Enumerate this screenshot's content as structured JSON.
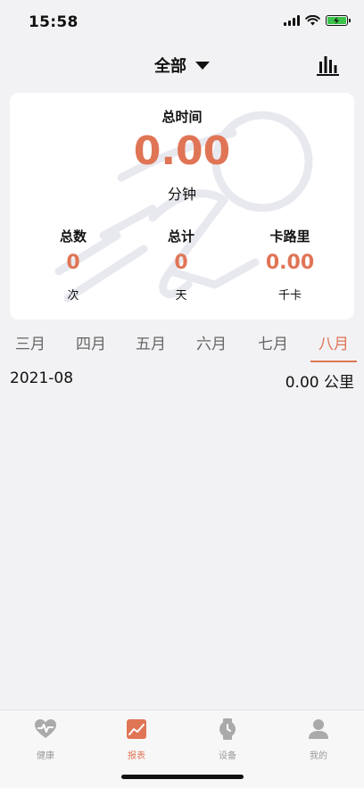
{
  "status_bar": {
    "time": "15:58"
  },
  "header": {
    "filter_label": "全部"
  },
  "summary": {
    "total_time_label": "总时间",
    "total_time_value": "0.00",
    "total_time_unit": "分钟",
    "stats": [
      {
        "label": "总数",
        "value": "0",
        "unit": "次"
      },
      {
        "label": "总计",
        "value": "0",
        "unit": "天"
      },
      {
        "label": "卡路里",
        "value": "0.00",
        "unit": "千卡"
      }
    ]
  },
  "months": [
    "三月",
    "四月",
    "五月",
    "六月",
    "七月",
    "八月"
  ],
  "active_month": "八月",
  "records": [
    {
      "date": "2021-08",
      "distance": "0.00 公里"
    }
  ],
  "bottom_nav": [
    {
      "label": "健康",
      "icon": "heart-pulse-icon"
    },
    {
      "label": "报表",
      "icon": "report-chart-icon",
      "active": true
    },
    {
      "label": "设备",
      "icon": "watch-icon"
    },
    {
      "label": "我的",
      "icon": "profile-icon"
    }
  ],
  "colors": {
    "accent": "#e07556",
    "background": "#f2f2f4",
    "inactive": "#999999",
    "battery": "#3cc34a"
  }
}
